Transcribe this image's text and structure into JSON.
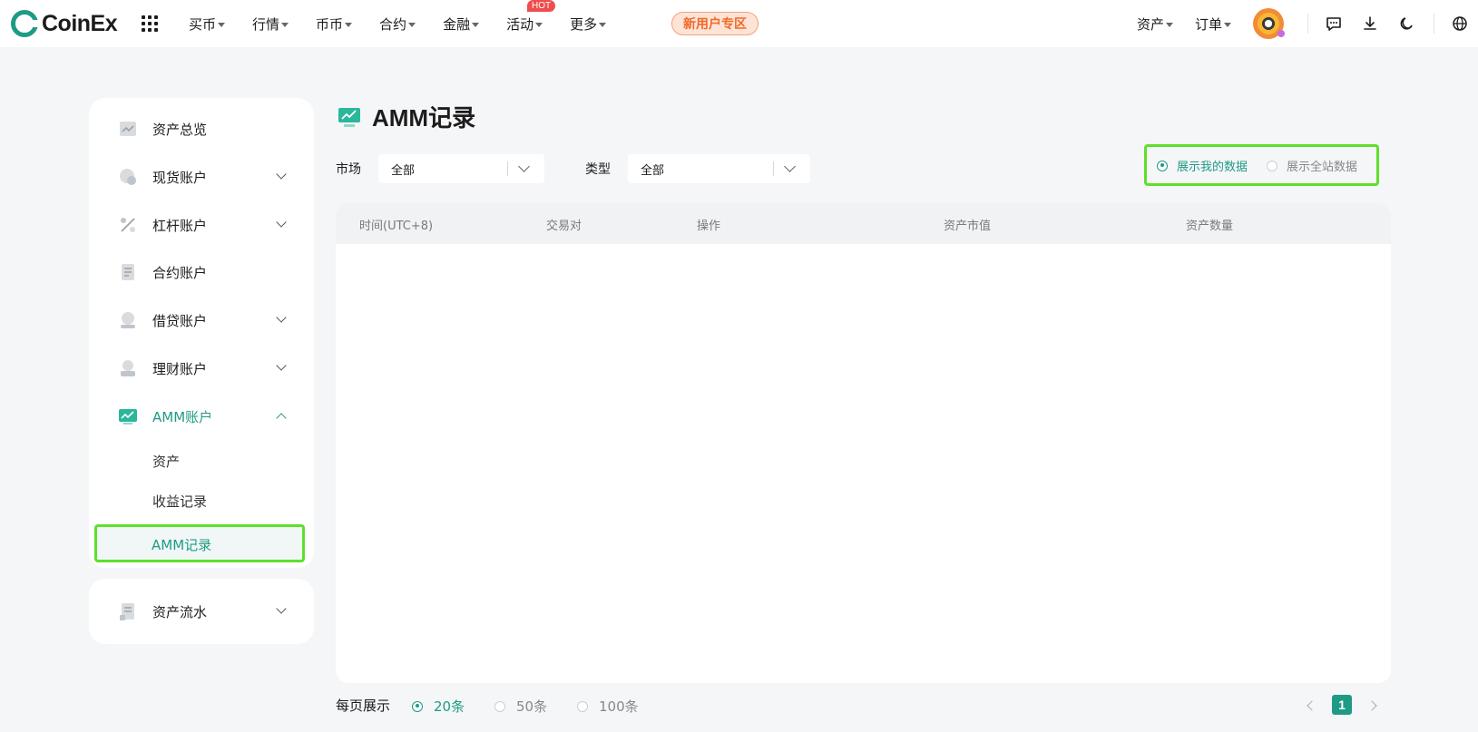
{
  "brand": {
    "name": "CoinEx",
    "accent": "#1f9b85",
    "highlight": "#5ee02a"
  },
  "nav": {
    "items": [
      {
        "label": "买币"
      },
      {
        "label": "行情"
      },
      {
        "label": "币币"
      },
      {
        "label": "合约"
      },
      {
        "label": "金融"
      },
      {
        "label": "活动",
        "badge": "HOT"
      },
      {
        "label": "更多"
      }
    ],
    "promo": "新用户专区",
    "right": {
      "assets": "资产",
      "orders": "订单"
    },
    "icons": [
      "chat-icon",
      "download-icon",
      "moon-icon",
      "globe-icon"
    ]
  },
  "sidebar": {
    "items": [
      {
        "label": "资产总览",
        "icon": "overview-icon"
      },
      {
        "label": "现货账户",
        "icon": "spot-icon"
      },
      {
        "label": "杠杆账户",
        "icon": "margin-icon"
      },
      {
        "label": "合约账户",
        "icon": "futures-icon"
      },
      {
        "label": "借贷账户",
        "icon": "loan-icon"
      },
      {
        "label": "理财账户",
        "icon": "finance-icon"
      },
      {
        "label": "AMM账户",
        "icon": "amm-icon"
      }
    ],
    "amm_sub": [
      "资产",
      "收益记录",
      "AMM记录"
    ],
    "bottom": {
      "label": "资产流水",
      "icon": "ledger-icon"
    }
  },
  "main": {
    "title": "AMM记录",
    "filters": {
      "market_label": "市场",
      "market_value": "全部",
      "type_label": "类型",
      "type_value": "全部"
    },
    "toggle": {
      "mine": "展示我的数据",
      "all": "展示全站数据",
      "selected": "mine"
    },
    "columns": [
      "时间(UTC+8)",
      "交易对",
      "操作",
      "资产市值",
      "资产数量"
    ],
    "rows": []
  },
  "pagination": {
    "per_page_label": "每页展示",
    "options": [
      "20条",
      "50条",
      "100条"
    ],
    "selected": "20条",
    "current_page": "1"
  }
}
